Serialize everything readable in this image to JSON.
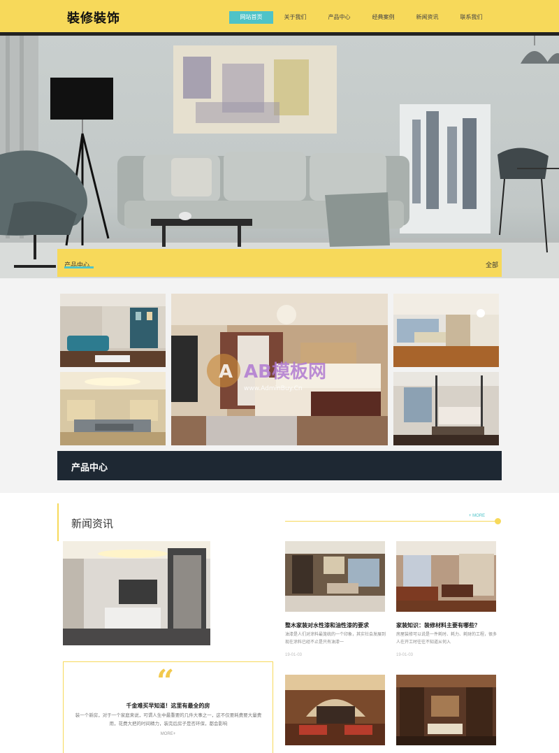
{
  "header": {
    "logo": "裝修裝饰",
    "nav": [
      "网站首页",
      "关于我们",
      "产品中心",
      "经典案例",
      "新闻资讯",
      "联系我们"
    ]
  },
  "hero": {
    "bar_title": "产品中心",
    "bar_all": "全部"
  },
  "products": {
    "banner_title": "产品中心",
    "watermark_text": "AB模板网",
    "watermark_url": "www.AdminBuy.Cn"
  },
  "news": {
    "title": "新闻资讯",
    "more": "+ MORE",
    "featured": {
      "quote_mark": "“",
      "title": "千金难买早知道！这里有最全的房",
      "text": "装一个新房，对于一个家庭来说，可谓人生中最重要的几件大事之一，这不仅要耗费要大量费用，花费大把的时间精力，装完后房子是否环保，都会影响",
      "more": "MORE+"
    },
    "items": [
      {
        "title": "整木家装对水性漆和油性漆的要求",
        "text": "油漆是人们对涂料最笼统的一个印象，其实社会发展到现在涂料已经不止是只有油漆一",
        "date": "19-01-03"
      },
      {
        "title": "家装知识：装修材料主要有哪些？",
        "text": "房屋装修可以说是一件耗时、耗力、耗财的工程，很多人在开工时往往不知道从何入",
        "date": "19-01-03"
      }
    ]
  },
  "colors": {
    "accent_yellow": "#f7d95a",
    "accent_teal": "#4fc3c8",
    "dark_banner": "#1e2833"
  }
}
